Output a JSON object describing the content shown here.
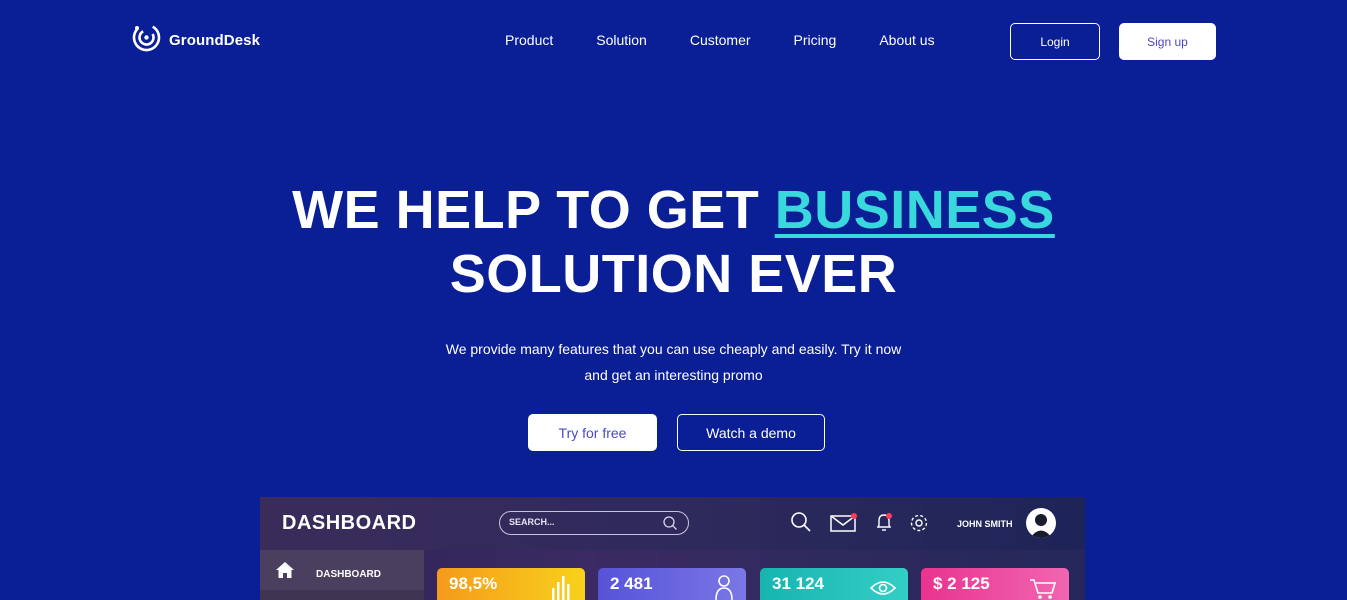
{
  "brand": {
    "name": "GroundDesk",
    "icon": "logo-icon"
  },
  "nav": {
    "links": [
      "Product",
      "Solution",
      "Customer",
      "Pricing",
      "About us"
    ]
  },
  "auth": {
    "login_label": "Login",
    "signup_label": "Sign up"
  },
  "hero": {
    "title_part1": "WE HELP TO GET ",
    "title_accent": "BUSINESS",
    "title_line2": "SOLUTION EVER",
    "subtitle_line1": "We provide many features that you can use cheaply and easily. Try it now",
    "subtitle_line2": "and get an interesting promo",
    "try_label": "Try for free",
    "demo_label": "Watch a demo"
  },
  "dashboard": {
    "title": "DASHBOARD",
    "search_placeholder": "SEARCH...",
    "user_name": "JOHN SMITH",
    "sidebar_item": "DASHBOARD",
    "stats": [
      {
        "value": "98,5%",
        "color_from": "#f59a1c",
        "color_to": "#f7d21a",
        "icon": "bar-chart-icon"
      },
      {
        "value": "2 481",
        "color_from": "#5653d8",
        "color_to": "#7a77e6",
        "icon": "user-icon"
      },
      {
        "value": "31 124",
        "color_from": "#17b4b0",
        "color_to": "#33cfc6",
        "icon": "eye-icon"
      },
      {
        "value": "$ 2 125",
        "color_from": "#e9338f",
        "color_to": "#f166b1",
        "icon": "cart-icon"
      }
    ]
  },
  "colors": {
    "background": "#0a1e96",
    "accent": "#38d8dc",
    "button_text": "#4a46c8"
  }
}
